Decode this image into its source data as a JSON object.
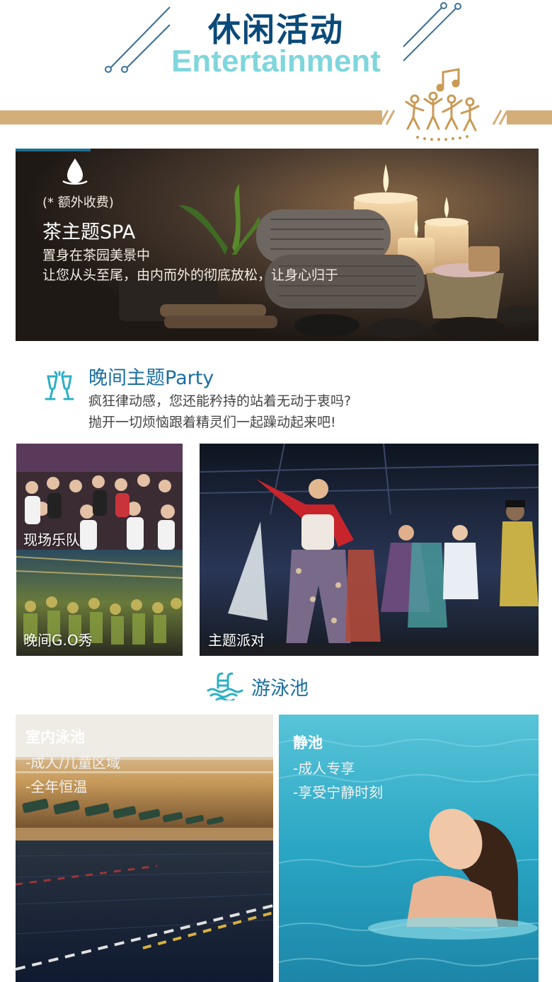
{
  "header": {
    "title": "休闲活动",
    "subtitle": "Entertainment"
  },
  "spa": {
    "note": "(* 额外收费)",
    "title": "茶主题SPA",
    "line1": "置身在茶园美景中",
    "line2": "让您从头至尾，由内而外的彻底放松，让身心归于"
  },
  "party": {
    "title": "晚间主题Party",
    "line1": "疯狂律动感，您还能矜持的站着无动于衷吗?",
    "line2": "抛开一切烦恼跟着精灵们一起躁动起来吧!",
    "captions": [
      "现场乐队",
      "晚间G.O秀",
      "主题派对"
    ]
  },
  "pool": {
    "title": "游泳池",
    "indoor": {
      "heading": "室内泳池",
      "lines": [
        "-成人/儿童区域",
        "-全年恒温"
      ]
    },
    "quiet": {
      "heading": "静池",
      "lines": [
        "-成人专享",
        "-享受宁静时刻"
      ]
    }
  },
  "colors": {
    "title_blue": "#0a4a7a",
    "sub_teal": "#7fd6dc",
    "gold": "#d4ae78",
    "section_blue": "#1a6ea0",
    "icon_teal": "#2bb0c4"
  },
  "icons": [
    "water-drop-icon",
    "champagne-glasses-icon",
    "pool-ladder-icon",
    "dancers-icon"
  ]
}
